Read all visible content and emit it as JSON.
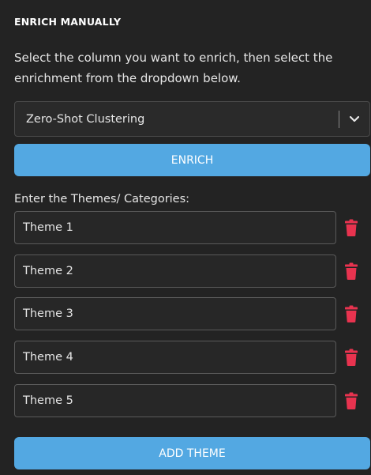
{
  "section": {
    "title": "ENRICH MANUALLY",
    "description": "Select the column you want to enrich, then select the enrichment from the dropdown below."
  },
  "enrichment_select": {
    "selected": "Zero-Shot Clustering",
    "icon": "chevron-down-icon"
  },
  "enrich_button": {
    "label": "ENRICH"
  },
  "themes": {
    "label": "Enter the Themes/ Categories:",
    "items": [
      {
        "value": "Theme 1",
        "delete_icon": "trash-icon"
      },
      {
        "value": "Theme 2",
        "delete_icon": "trash-icon"
      },
      {
        "value": "Theme 3",
        "delete_icon": "trash-icon"
      },
      {
        "value": "Theme 4",
        "delete_icon": "trash-icon"
      },
      {
        "value": "Theme 5",
        "delete_icon": "trash-icon"
      }
    ]
  },
  "add_theme_button": {
    "label": "ADD THEME"
  },
  "colors": {
    "background": "#232323",
    "accent": "#53a8e2",
    "delete": "#e8334f",
    "text": "#e6e6e6"
  }
}
